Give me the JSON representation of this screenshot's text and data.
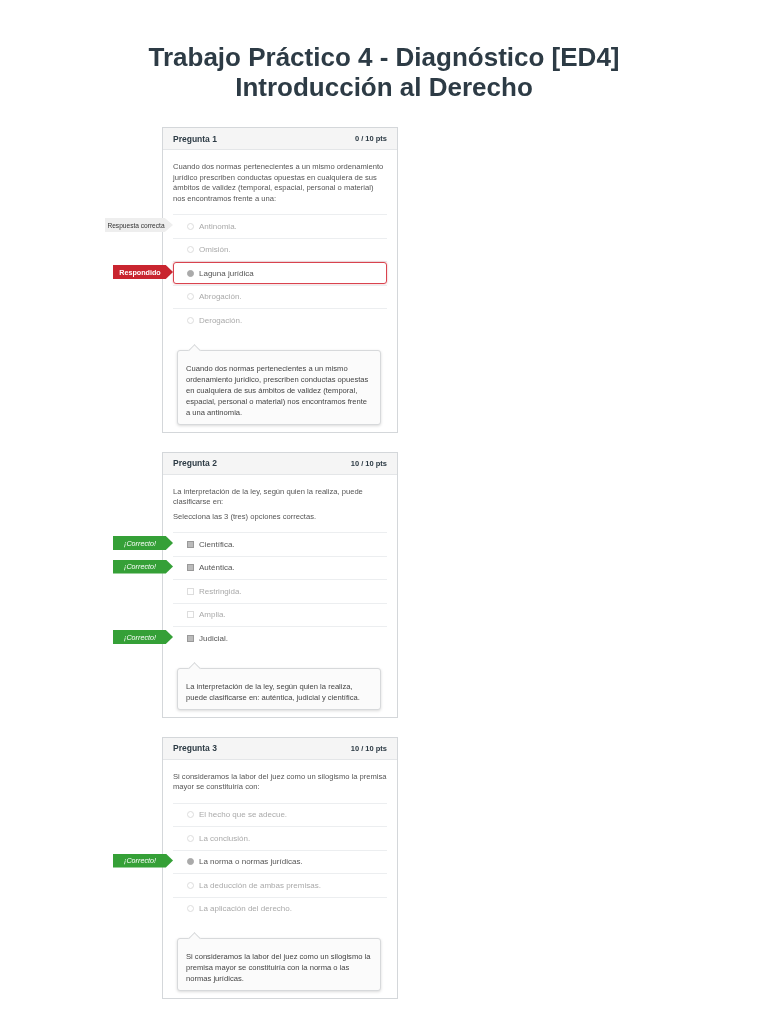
{
  "title": [
    "Trabajo Práctico 4 - Diagnóstico [ED4]",
    "Introducción al Derecho"
  ],
  "questions": [
    {
      "title": "Pregunta 1",
      "points": "0 / 10 pts",
      "prompt": "Cuando dos normas pertenecientes a un mismo ordenamiento jurídico prescriben conductas opuestas en cualquiera de sus ámbitos de validez (temporal, espacial, personal o material) nos encontramos frente a una:",
      "kind": "radio",
      "answers": [
        {
          "text": "Antinomia.",
          "selected": false,
          "flag": {
            "kind": "correct-answer",
            "label": "Respuesta correcta"
          }
        },
        {
          "text": "Omisión.",
          "selected": false
        },
        {
          "text": "Laguna jurídica",
          "selected": true,
          "flag": {
            "kind": "answered",
            "label": "Respondido"
          }
        },
        {
          "text": "Abrogación.",
          "selected": false
        },
        {
          "text": "Derogación.",
          "selected": false
        }
      ],
      "comment": "Cuando dos normas pertenecientes a un mismo ordenamiento  jurídico, prescriben conductas opuestas en cualquiera de sus ámbitos de validez (temporal, espacial, personal o material) nos encontramos frente a una antinomia."
    },
    {
      "title": "Pregunta 2",
      "points": "10 / 10 pts",
      "prompt": "La interpretación de la ley, según quien la realiza, puede clasificarse en:",
      "instruction": "Selecciona las 3 (tres) opciones correctas.",
      "kind": "checkbox",
      "answers": [
        {
          "text": "Científica.",
          "selected": true,
          "flag": {
            "kind": "correct",
            "label": "¡Correcto!"
          }
        },
        {
          "text": "Auténtica.",
          "selected": true,
          "flag": {
            "kind": "correct",
            "label": "¡Correcto!"
          }
        },
        {
          "text": "Restringida.",
          "selected": false
        },
        {
          "text": "Amplia.",
          "selected": false
        },
        {
          "text": "Judicial.",
          "selected": true,
          "flag": {
            "kind": "correct",
            "label": "¡Correcto!"
          }
        }
      ],
      "comment": "La interpretación de la ley, según quien la realiza, puede clasificarse en: auténtica, judicial y científica."
    },
    {
      "title": "Pregunta 3",
      "points": "10 / 10 pts",
      "prompt": "Si consideramos la labor del juez como un silogismo la premisa mayor se constituiría con:",
      "kind": "radio",
      "answers": [
        {
          "text": "El hecho que se adecue.",
          "selected": false
        },
        {
          "text": "La conclusión.",
          "selected": false
        },
        {
          "text": "La norma o normas jurídicas.",
          "selected": true,
          "flag": {
            "kind": "correct",
            "label": "¡Correcto!"
          }
        },
        {
          "text": "La deducción de ambas premisas.",
          "selected": false
        },
        {
          "text": "La aplicación del derecho.",
          "selected": false
        }
      ],
      "comment": "Si consideramos la labor del juez como un silogismo la premisa mayor se constituiría con la norma o las normas jurídicas."
    }
  ]
}
